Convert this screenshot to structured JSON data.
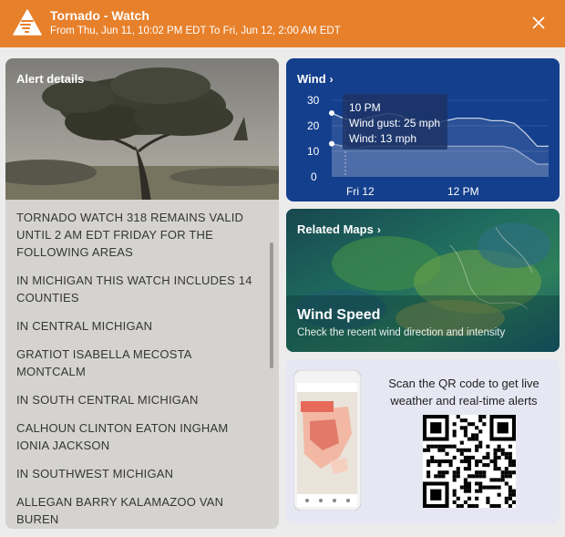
{
  "header": {
    "title": "Tornado - Watch",
    "subtitle": "From Thu, Jun 11, 10:02 PM EDT To Fri, Jun 12, 2:00 AM EDT",
    "icon": "tornado-warning-icon",
    "close_icon": "close-icon"
  },
  "alert": {
    "label": "Alert details",
    "paragraphs": [
      "TORNADO WATCH 318 REMAINS VALID UNTIL 2 AM EDT FRIDAY FOR THE FOLLOWING AREAS",
      "IN MICHIGAN THIS WATCH INCLUDES 14 COUNTIES",
      "IN CENTRAL MICHIGAN",
      "GRATIOT ISABELLA MECOSTA MONTCALM",
      "IN SOUTH CENTRAL MICHIGAN",
      "CALHOUN CLINTON EATON INGHAM IONIA JACKSON",
      "IN SOUTHWEST MICHIGAN",
      "ALLEGAN BARRY KALAMAZOO VAN BUREN"
    ]
  },
  "wind": {
    "title": "Wind",
    "chevron": "›",
    "y_ticks": [
      "30",
      "20",
      "10",
      "0"
    ],
    "x_ticks": [
      "Fri 12",
      "12 PM"
    ],
    "tooltip": {
      "time": "10 PM",
      "gust": "Wind gust: 25 mph",
      "wind": "Wind: 13 mph"
    },
    "chart_data": {
      "type": "area",
      "ylim": [
        0,
        30
      ],
      "series": [
        {
          "values": [
            25,
            23,
            22,
            23,
            24,
            25,
            24,
            22,
            20,
            21,
            22,
            23,
            23,
            23,
            22,
            22,
            21,
            17,
            12,
            12
          ]
        },
        {
          "values": [
            13,
            12,
            11,
            12,
            12,
            12,
            12,
            12,
            12,
            12,
            12,
            12,
            12,
            12,
            12,
            12,
            11,
            8,
            5,
            5
          ]
        }
      ]
    }
  },
  "maps": {
    "title": "Related Maps",
    "chevron": "›",
    "headline": "Wind Speed",
    "description": "Check the recent wind direction and intensity"
  },
  "qr": {
    "text": "Scan the QR code to get live weather and real-time alerts",
    "phone_icon": "app-preview-phone",
    "qr_icon": "qr-code"
  }
}
